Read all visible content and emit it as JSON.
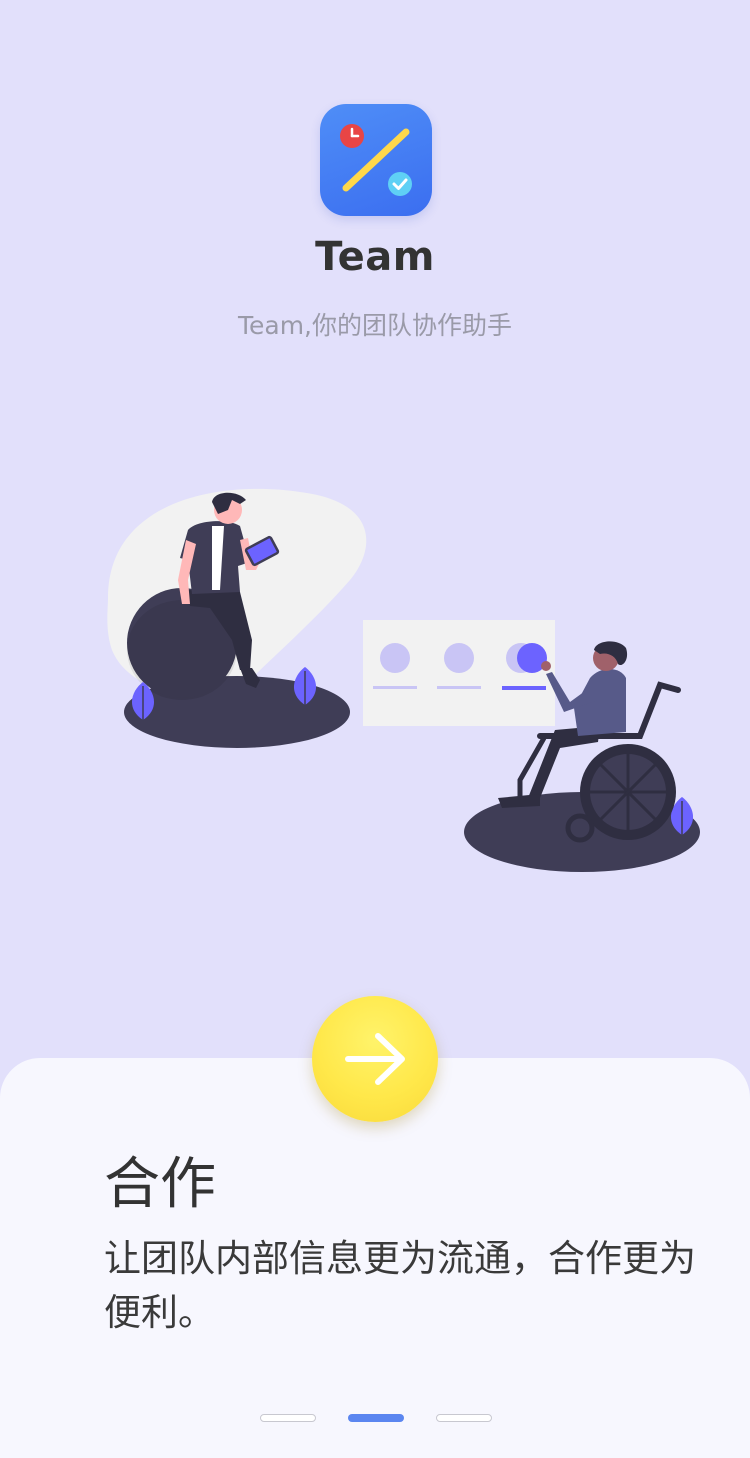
{
  "app": {
    "name": "Team",
    "tagline": "Team,你的团队协作助手",
    "icon": "calendar-check-icon"
  },
  "illustration": {
    "name": "team-collaboration-illustration"
  },
  "next_button": {
    "icon": "arrow-right-icon"
  },
  "panel": {
    "title": "合作",
    "description": "让团队内部信息更为流通，合作更为便利。"
  },
  "pagination": {
    "total": 3,
    "current": 2
  },
  "colors": {
    "background": "#e2e0fb",
    "panel": "#f7f7fe",
    "accent": "#5b86f0",
    "button": "#ffe84a",
    "illustration_purple": "#6c63ff",
    "illustration_dark": "#3f3d56"
  }
}
